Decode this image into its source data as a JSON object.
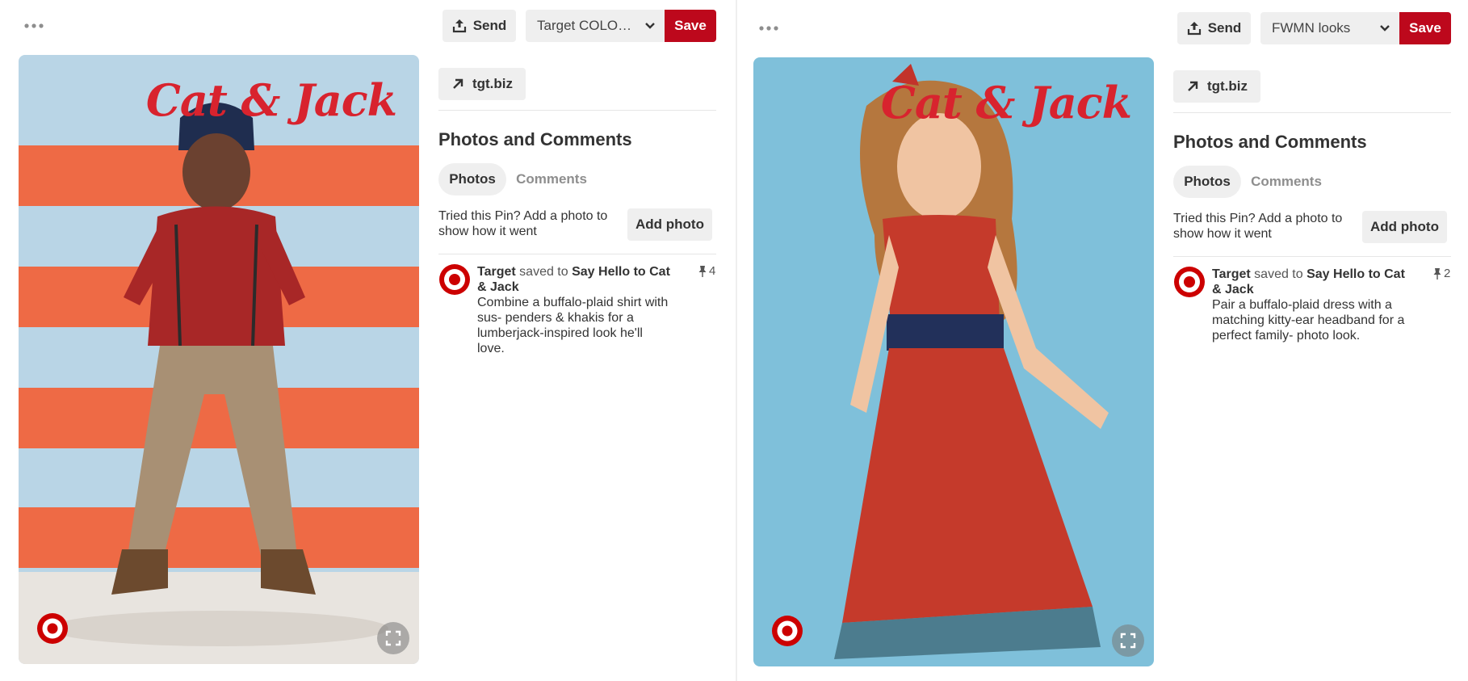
{
  "brand_color": "#bd081c",
  "panels": [
    {
      "more_icon": "ellipsis-icon",
      "send_label": "Send",
      "board_value": "Target COLOR A...",
      "save_label": "Save",
      "image_brand_text": "Cat & Jack",
      "link_label": "tgt.biz",
      "section_title": "Photos and Comments",
      "tab_photos": "Photos",
      "tab_comments": "Comments",
      "tried_text": "Tried this Pin? Add a photo to show how it went",
      "add_photo_label": "Add photo",
      "activity": {
        "user": "Target",
        "verb": " saved to ",
        "board": "Say Hello to Cat & Jack",
        "description": "Combine a buffalo-plaid shirt with sus- penders & khakis for a lumberjack-inspired look he'll love.",
        "repin_count": "4"
      }
    },
    {
      "more_icon": "ellipsis-icon",
      "send_label": "Send",
      "board_value": "FWMN looks",
      "save_label": "Save",
      "image_brand_text": "Cat & Jack",
      "link_label": "tgt.biz",
      "section_title": "Photos and Comments",
      "tab_photos": "Photos",
      "tab_comments": "Comments",
      "tried_text": "Tried this Pin? Add a photo to show how it went",
      "add_photo_label": "Add photo",
      "activity": {
        "user": "Target",
        "verb": " saved to ",
        "board": "Say Hello to Cat & Jack",
        "description": "Pair a buffalo-plaid dress with a matching kitty-ear headband for a perfect family- photo look.",
        "repin_count": "2"
      }
    }
  ]
}
